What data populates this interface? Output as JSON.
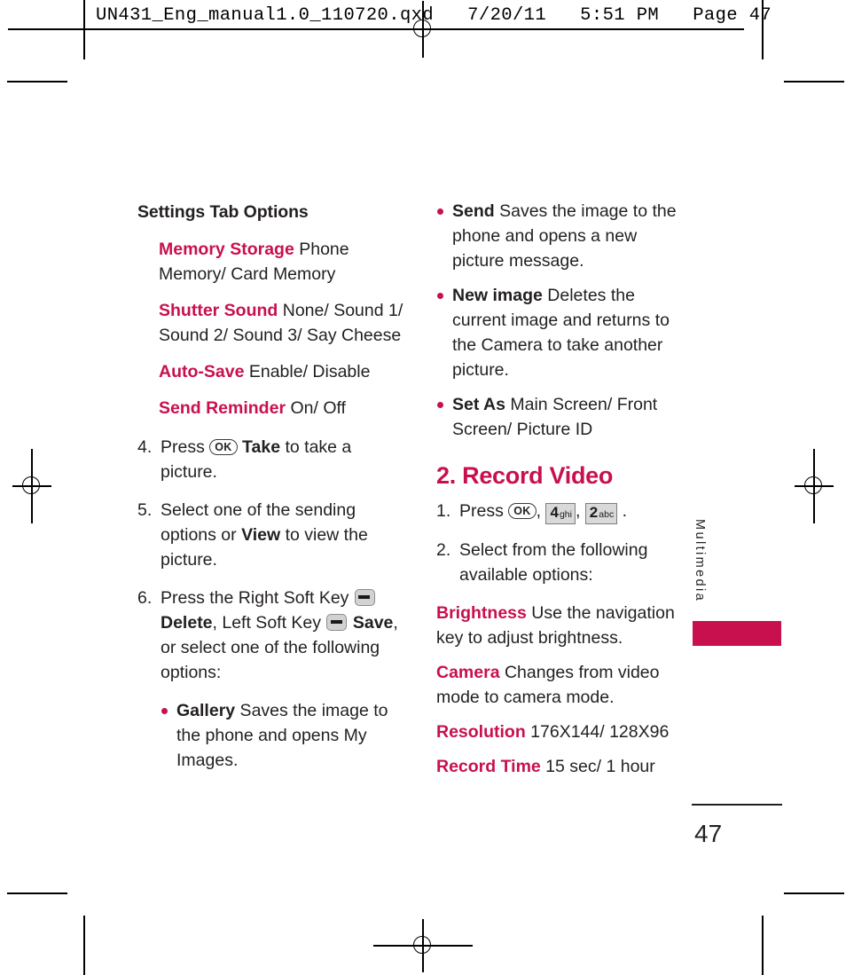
{
  "header": {
    "text": "UN431_Eng_manual1.0_110720.qxd   7/20/11   5:51 PM   Page 47"
  },
  "colors": {
    "accent": "#C8104E",
    "text": "#231f20"
  },
  "left_column": {
    "section_title": "Settings Tab Options",
    "options": [
      {
        "term": "Memory Storage",
        "desc": " Phone Memory/ Card Memory"
      },
      {
        "term": "Shutter Sound",
        "desc": " None/ Sound 1/ Sound 2/ Sound 3/ Say Cheese"
      },
      {
        "term": "Auto-Save",
        "desc": " Enable/ Disable"
      },
      {
        "term": "Send Reminder",
        "desc": " On/ Off"
      }
    ],
    "step4": {
      "num": "4.",
      "pre": "Press ",
      "key": "OK",
      "bold": "Take",
      "post": " to take a picture."
    },
    "step5": {
      "num": "5.",
      "pre": "Select one of the sending options or ",
      "bold": "View",
      "post": " to view the picture."
    },
    "step6": {
      "num": "6.",
      "pre": "Press the Right Soft Key",
      "bold1": "Delete",
      "mid": ", Left Soft Key",
      "bold2": "Save",
      "post": ", or select one of the following options:"
    },
    "bullets": [
      {
        "term": "Gallery",
        "desc": " Saves the image to the phone and opens My Images."
      }
    ]
  },
  "right_column": {
    "bullets": [
      {
        "term": "Send",
        "desc": " Saves the image to the phone and opens a new picture message."
      },
      {
        "term": "New image",
        "desc": " Deletes the current image and returns to the Camera to take another picture."
      },
      {
        "term": "Set As",
        "desc": " Main Screen/ Front Screen/ Picture ID"
      }
    ],
    "heading": "2. Record Video",
    "step1": {
      "num": "1.",
      "pre": "Press ",
      "key_ok": "OK",
      "key2_digit": "4",
      "key2_sub": "ghi",
      "key3_digit": "2",
      "key3_sub": "abc",
      "post": "."
    },
    "step2": {
      "num": "2.",
      "text": "Select from the following available options:"
    },
    "options": [
      {
        "term": "Brightness",
        "desc": " Use the navigation key to adjust brightness."
      },
      {
        "term": "Camera",
        "desc": "  Changes from video mode to camera mode."
      },
      {
        "term": "Resolution",
        "desc": "  176X144/ 128X96"
      },
      {
        "term": "Record Time",
        "desc": "  15 sec/ 1 hour"
      }
    ]
  },
  "side_tab": {
    "label": "Multimedia"
  },
  "footer": {
    "page_number": "47"
  }
}
